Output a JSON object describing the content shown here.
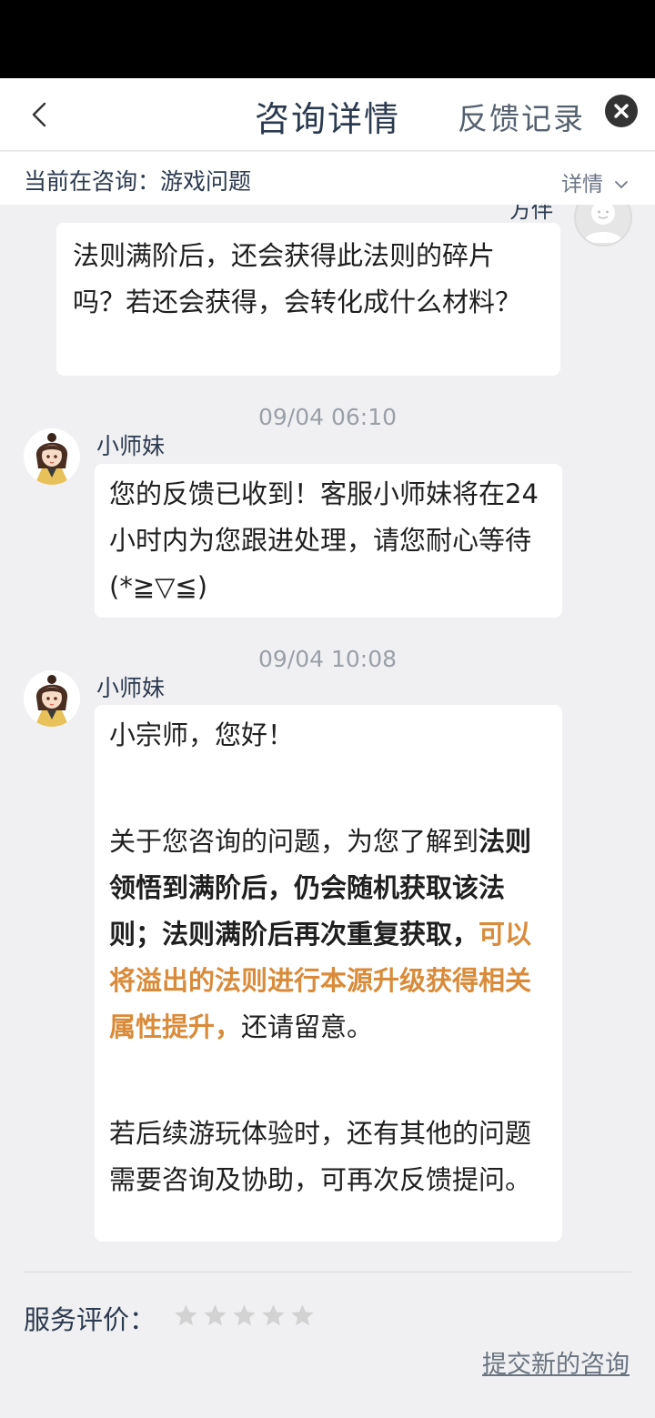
{
  "header": {
    "title": "咨询详情",
    "feedback_link": "反馈记录",
    "close_icon": "close-icon",
    "back_icon": "chevron-left-icon"
  },
  "subbar": {
    "current_label": "当前在咨询：",
    "current_topic": "游戏问题",
    "detail_label": "详情"
  },
  "messages": {
    "user_partial_name": "方伴",
    "user_message": "法则满阶后，还会获得此法则的碎片吗？若还会获得，会转化成什么材料？",
    "msg1": {
      "timestamp": "09/04 06:10",
      "sender": "小师妹",
      "text": "您的反馈已收到！客服小师妹将在24小时内为您跟进处理，请您耐心等待 (*≧▽≦)"
    },
    "msg2": {
      "timestamp": "09/04 10:08",
      "sender": "小师妹",
      "greeting": "小宗师，您好！",
      "para1_plain": "关于您咨询的问题，为您了解到",
      "para1_bold": "法则领悟到满阶后，仍会随机获取该法则；法则满阶后再次重复获取，",
      "para1_orange": "可以将溢出的法则进行本源升级获得相关属性提升，",
      "para1_end": "还请留意。",
      "para2": "若后续游玩体验时，还有其他的问题需要咨询及协助，可再次反馈提问。"
    }
  },
  "footer": {
    "rating_label": "服务评价：",
    "rating_value": 0,
    "rating_max": 5,
    "new_consult": "提交新的咨询"
  },
  "colors": {
    "accent_orange": "#d98b3a",
    "title": "#2c3a4f",
    "background": "#f0f0f2"
  }
}
